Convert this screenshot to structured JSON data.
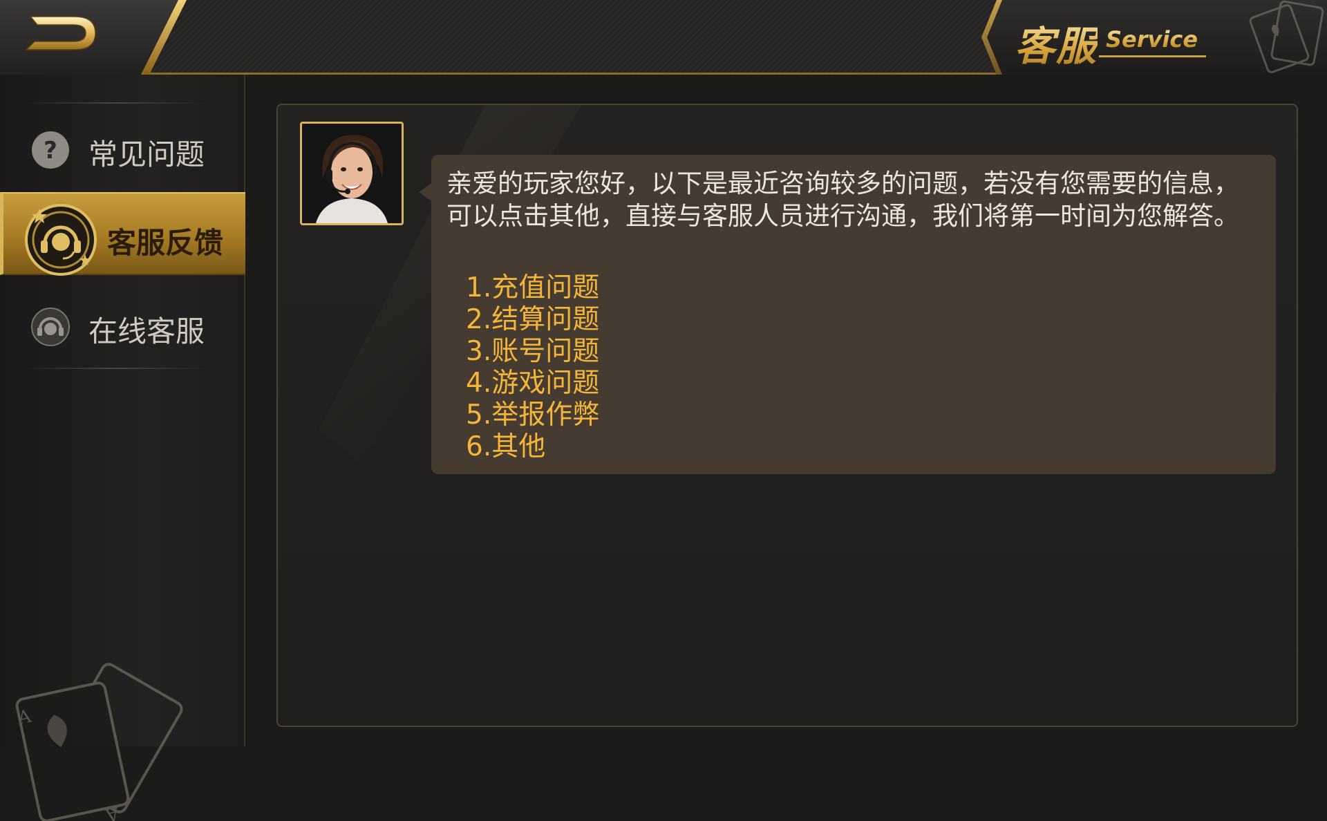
{
  "header": {
    "title_cn": "客服",
    "title_en": "Service"
  },
  "sidebar": {
    "items": [
      {
        "label": "常见问题",
        "icon": "question-icon",
        "active": false
      },
      {
        "label": "客服反馈",
        "icon": "headset-icon",
        "active": true
      },
      {
        "label": "在线客服",
        "icon": "headset-icon",
        "active": false
      }
    ]
  },
  "main": {
    "message": "亲爱的玩家您好，以下是最近咨询较多的问题，若没有您需要的信息，可以点击其他，直接与客服人员进行沟通，我们将第一时间为您解答。",
    "options": [
      "1.充值问题",
      "2.结算问题",
      "3.账号问题",
      "4.游戏问题",
      "5.举报作弊",
      "6.其他"
    ]
  },
  "colors": {
    "accent_gold": "#d9b458",
    "option_text": "#f5b53a",
    "bubble_bg": "#463b30"
  }
}
